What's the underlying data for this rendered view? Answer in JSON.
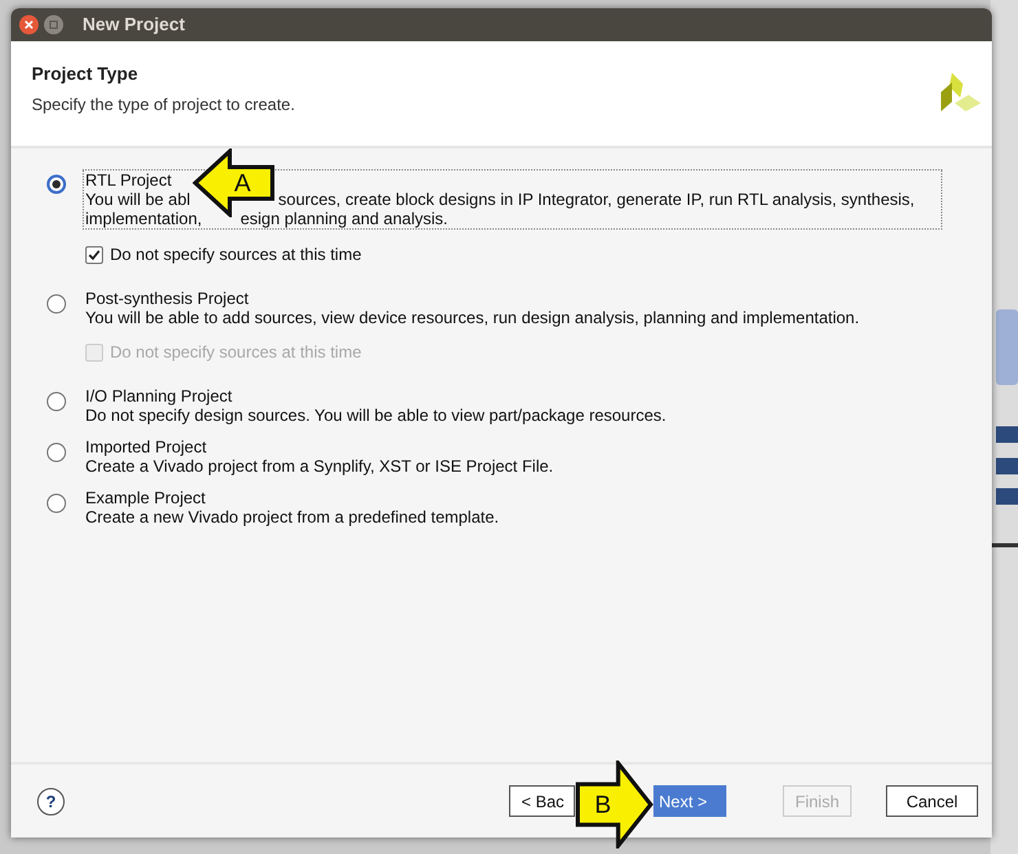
{
  "window": {
    "title": "New Project"
  },
  "header": {
    "title": "Project Type",
    "subtitle": "Specify the type of project to create."
  },
  "options": [
    {
      "label": "RTL Project",
      "description_lines": [
        [
          "You will be abl",
          "sources, create block designs in IP Integrator, generate IP, run RTL analysis, synthesis,"
        ],
        [
          "implementation,",
          "esign planning and analysis."
        ]
      ],
      "selected": true,
      "focused": true,
      "checkbox": {
        "label": "Do not specify sources at this time",
        "checked": true,
        "disabled": false
      }
    },
    {
      "label": "Post-synthesis Project",
      "description": "You will be able to add sources, view device resources, run design analysis, planning and implementation.",
      "selected": false,
      "focused": false,
      "checkbox": {
        "label": "Do not specify sources at this time",
        "checked": false,
        "disabled": true
      }
    },
    {
      "label": "I/O Planning Project",
      "description": "Do not specify design sources. You will be able to view part/package resources.",
      "selected": false,
      "focused": false
    },
    {
      "label": "Imported Project",
      "description": "Create a Vivado project from a Synplify, XST or ISE Project File.",
      "selected": false,
      "focused": false
    },
    {
      "label": "Example Project",
      "description": "Create a new Vivado project from a predefined template.",
      "selected": false,
      "focused": false
    }
  ],
  "footer": {
    "help": "?",
    "buttons": [
      {
        "label": "< Bac",
        "primary": false,
        "disabled": false
      },
      {
        "label": "Next >",
        "primary": true,
        "disabled": false
      },
      {
        "label": "Finish",
        "primary": false,
        "disabled": true
      },
      {
        "label": "Cancel",
        "primary": false,
        "disabled": false
      }
    ]
  },
  "callouts": [
    {
      "label": "A"
    },
    {
      "label": "B"
    }
  ]
}
